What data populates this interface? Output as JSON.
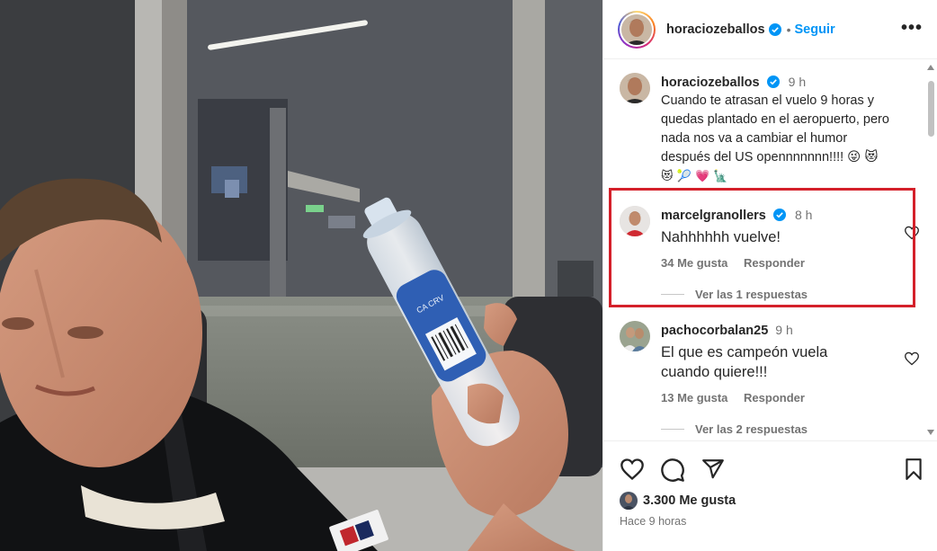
{
  "post": {
    "author": "horaciozeballos",
    "follow_label": "Seguir",
    "separator": "•",
    "more_label": "•••",
    "caption": {
      "author": "horaciozeballos",
      "time": "9 h",
      "text": "Cuando te atrasan el vuelo 9 horas y quedas plantado en el aeropuerto, pero nada nos va a cambiar el humor después del US opennnnnnn!!!! 😜 😻",
      "emojis_line2": "😻 🎾 💗 🗽"
    },
    "photo": {
      "bottle_label": "CA CRV"
    }
  },
  "comments": [
    {
      "author": "marcelgranollers",
      "verified": true,
      "time": "8 h",
      "text": "Nahhhhhh vuelve!",
      "likes": "34 Me gusta",
      "reply_label": "Responder",
      "view_replies": "Ver las 1 respuestas",
      "highlighted": true
    },
    {
      "author": "pachocorbalan25",
      "verified": false,
      "time": "9 h",
      "text": "El que es campeón vuela cuando quiere!!!",
      "likes": "13 Me gusta",
      "reply_label": "Responder",
      "view_replies": "Ver las 2 respuestas",
      "highlighted": false
    }
  ],
  "footer": {
    "likes": "3.300 Me gusta",
    "time_ago": "Hace 9 horas"
  },
  "icons": {
    "like": "heart-icon",
    "comment": "comment-icon",
    "share": "share-icon",
    "save": "bookmark-icon",
    "verified": "verified-badge-icon"
  },
  "colors": {
    "link_blue": "#0095f6",
    "verified_blue": "#0095f6",
    "highlight_red": "#d4202a",
    "muted": "#737373"
  }
}
